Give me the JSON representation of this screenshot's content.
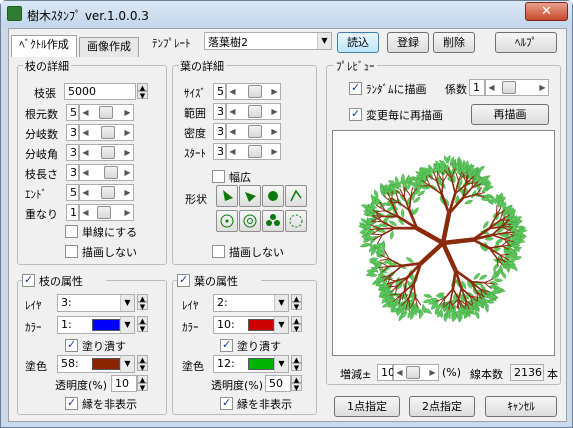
{
  "window": {
    "title": "樹木ｽﾀﾝﾌﾟ ver.1.0.0.3",
    "close_label": "✕"
  },
  "tabs": [
    {
      "label": "ﾍﾞｸﾄﾙ作成"
    },
    {
      "label": "画像作成"
    }
  ],
  "template": {
    "label": "ﾃﾝﾌﾟﾚｰﾄ",
    "value": "落葉樹2"
  },
  "toolbar": {
    "load": "読込",
    "register": "登録",
    "delete": "削除",
    "help": "ﾍﾙﾌﾟ"
  },
  "branch_details": {
    "title": "枝の詳細",
    "trunk_label": "枝張",
    "trunk_value": "5000",
    "rows": [
      {
        "label": "根元数",
        "value": "5",
        "level": 0.45
      },
      {
        "label": "分岐数",
        "value": "3",
        "level": 0.6
      },
      {
        "label": "分岐角",
        "value": "3",
        "level": 0.6
      },
      {
        "label": "枝長さ",
        "value": "3",
        "level": 0.75
      },
      {
        "label": "ｴﾝﾄﾞ",
        "value": "5",
        "level": 0.6
      },
      {
        "label": "重なり",
        "value": "1",
        "level": 0.35
      }
    ],
    "single_line": "単線にする",
    "no_draw": "描画しない"
  },
  "leaf_details": {
    "title": "葉の詳細",
    "rows": [
      {
        "label": "ｻｲｽﾞ",
        "value": "5",
        "level": 0.6
      },
      {
        "label": "範囲",
        "value": "3",
        "level": 0.6
      },
      {
        "label": "密度",
        "value": "3",
        "level": 0.6
      },
      {
        "label": "ｽﾀｰﾄ",
        "value": "3",
        "level": 0.6
      }
    ],
    "widen": "幅広",
    "shape_label": "形状",
    "no_draw": "描画しない"
  },
  "branch_attr": {
    "title": "枝の属性",
    "layer_label": "ﾚｲﾔ",
    "layer_value": "3:",
    "color_label": "ｶﾗｰ",
    "color_value": "1:",
    "color": "#0000ff",
    "fill_label": "塗り潰す",
    "fill_color_label": "塗色",
    "fill_color_value": "58:",
    "fill_color": "#8b2500",
    "opacity_label": "透明度(%)",
    "opacity_value": "10",
    "hide_edge": "縁を非表示"
  },
  "leaf_attr": {
    "title": "葉の属性",
    "layer_label": "ﾚｲﾔ",
    "layer_value": "2:",
    "color_label": "ｶﾗｰ",
    "color_value": "10:",
    "color": "#cc0000",
    "fill_label": "塗り潰す",
    "fill_color_label": "塗色",
    "fill_color_value": "12:",
    "fill_color": "#00b400",
    "opacity_label": "透明度(%)",
    "opacity_value": "50",
    "hide_edge": "縁を非表示"
  },
  "preview": {
    "title": "ﾌﾟﾚﾋﾞｭｰ",
    "random_label": "ﾗﾝﾀﾞﾑに描画",
    "coef_label": "係数",
    "coef_value": "1",
    "redraw_on_change": "変更毎に再描画",
    "redraw_button": "再描画",
    "increase_label": "増減±",
    "increase_value": "10",
    "percent_label": "(%)",
    "line_count_label": "線本数",
    "line_count_value": "2136",
    "line_count_unit": "本",
    "trunk_color": "#8b2a0a",
    "leaf_color": "#5ec95e"
  },
  "footer": {
    "one_point": "1点指定",
    "two_point": "2点指定",
    "cancel": "ｷｬﾝｾﾙ"
  }
}
